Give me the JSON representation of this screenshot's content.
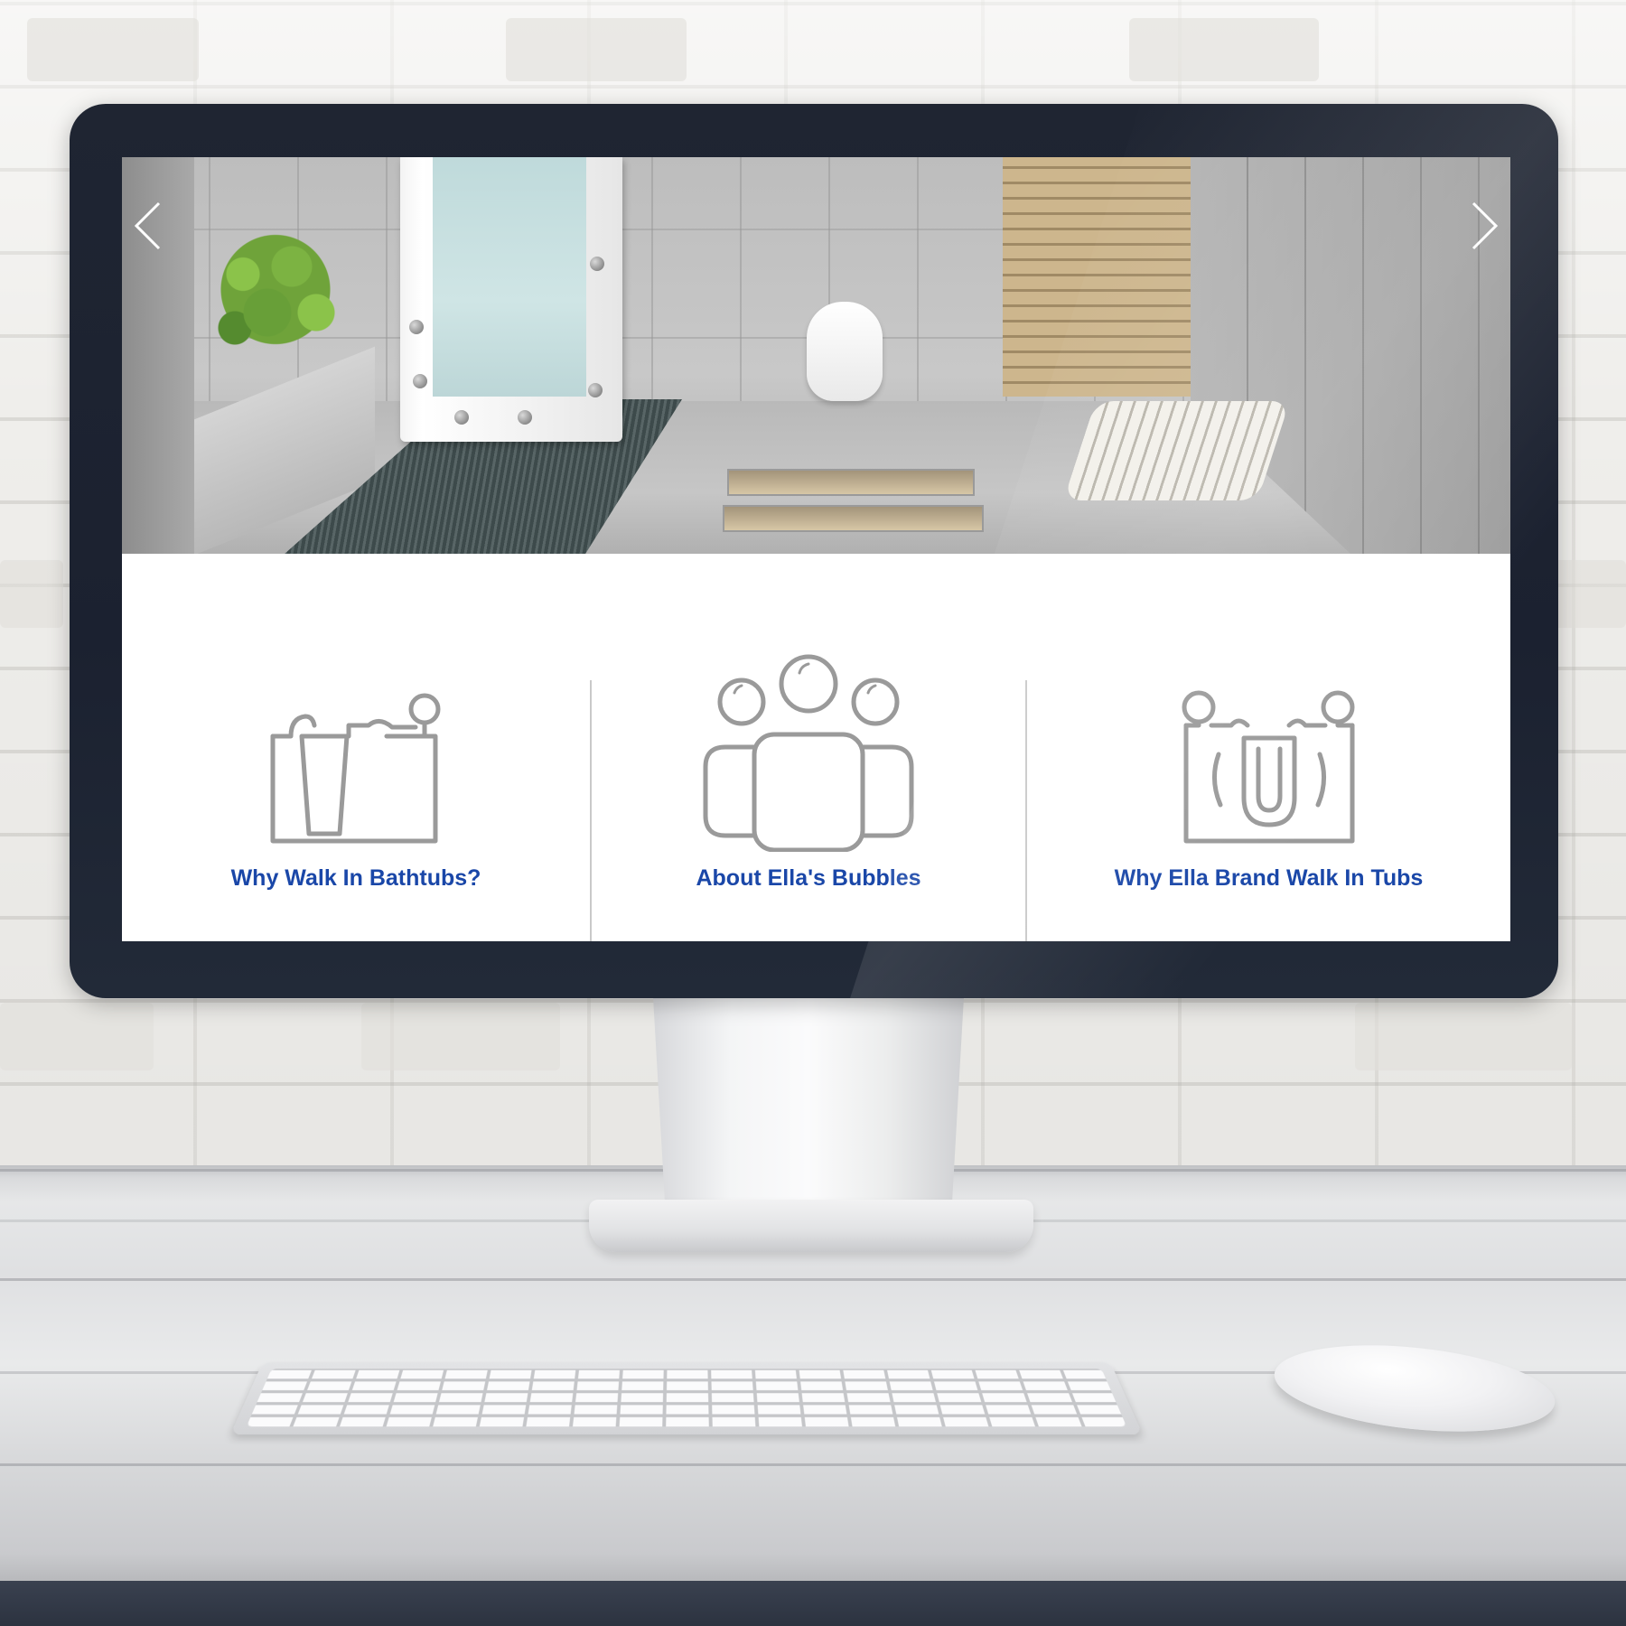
{
  "slider": {
    "prev_icon": "chevron-left-icon",
    "next_icon": "chevron-right-icon"
  },
  "features": [
    {
      "icon": "walk-in-bathtub-icon",
      "title": "Why Walk In Bathtubs?"
    },
    {
      "icon": "bubbles-group-icon",
      "title": "About Ella's Bubbles"
    },
    {
      "icon": "double-seat-tub-icon",
      "title": "Why Ella Brand Walk In Tubs"
    }
  ],
  "colors": {
    "link_blue": "#1a47a8",
    "icon_gray": "#9a9a9a",
    "bezel": "#1f2532"
  }
}
